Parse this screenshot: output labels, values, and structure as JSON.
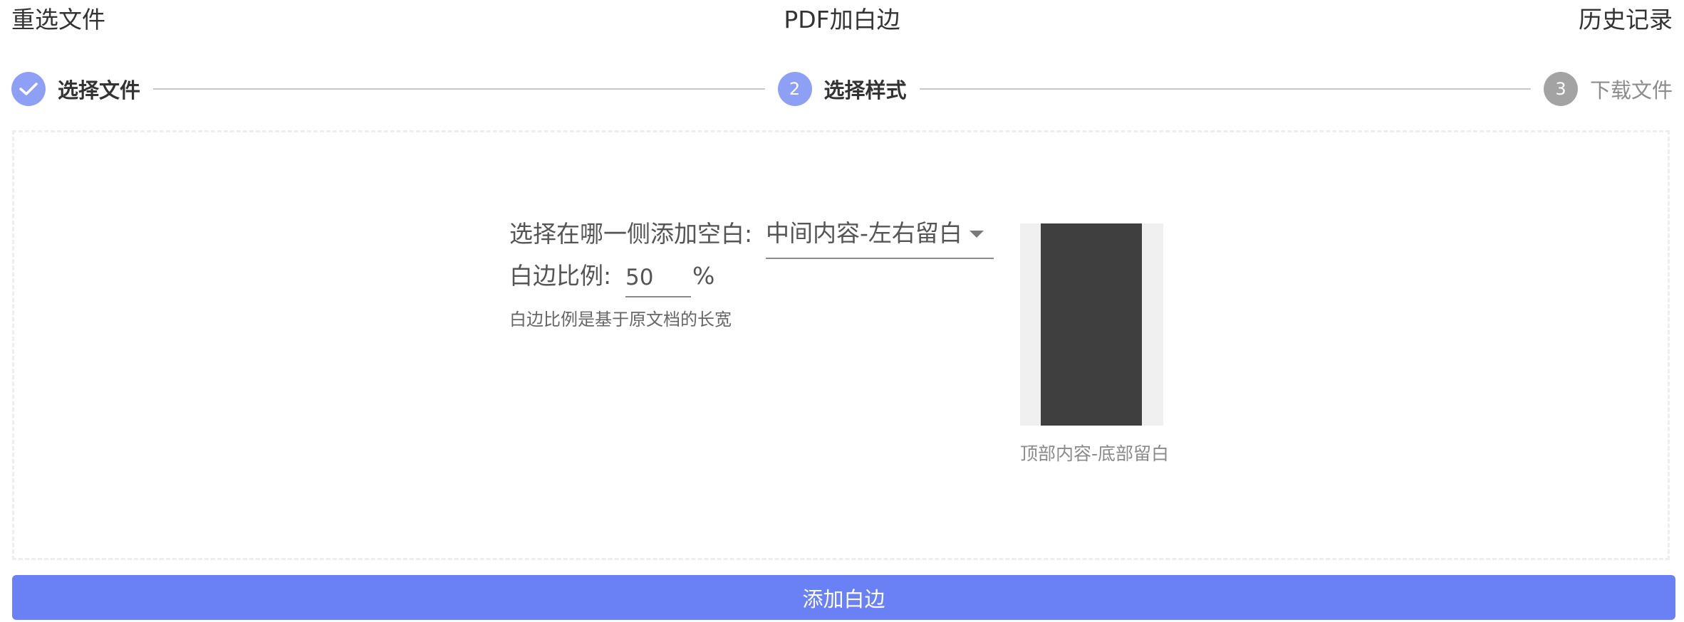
{
  "header": {
    "reselect_label": "重选文件",
    "title": "PDF加白边",
    "history_label": "历史记录"
  },
  "steps": [
    {
      "number": "1",
      "label": "选择文件",
      "state": "done",
      "icon": "check-icon"
    },
    {
      "number": "2",
      "label": "选择样式",
      "state": "active"
    },
    {
      "number": "3",
      "label": "下载文件",
      "state": "pending"
    }
  ],
  "form": {
    "side_label": "选择在哪一侧添加空白:",
    "side_selected": "中间内容-左右留白",
    "ratio_label": "白边比例:",
    "ratio_value": "50",
    "ratio_unit": "%",
    "hint": "白边比例是基于原文档的长宽"
  },
  "preview": {
    "caption": "顶部内容-底部留白"
  },
  "submit": {
    "label": "添加白边"
  },
  "colors": {
    "step_active": "#8ea0f6",
    "step_pending": "#a3a3a3",
    "button": "#6a80f5",
    "preview_content": "#3f3f3f",
    "preview_margin": "#f0f0f0"
  }
}
